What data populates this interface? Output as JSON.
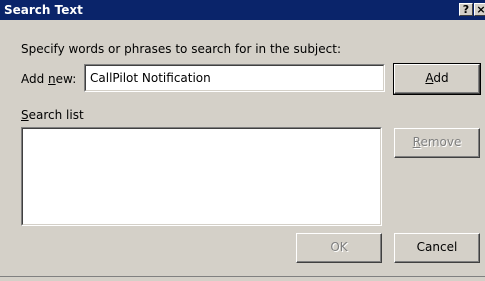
{
  "window": {
    "title": "Search Text",
    "help_glyph": "?",
    "close_glyph": "×"
  },
  "instruction": "Specify words or phrases to search for in the subject:",
  "add_new": {
    "label_pre": "Add ",
    "label_accel": "n",
    "label_post": "ew:",
    "value": "CallPilot Notification"
  },
  "search_list": {
    "label_accel": "S",
    "label_post": "earch list",
    "items": []
  },
  "buttons": {
    "add_accel": "A",
    "add_post": "dd",
    "remove_accel": "R",
    "remove_post": "emove",
    "ok": "OK",
    "cancel": "Cancel"
  }
}
